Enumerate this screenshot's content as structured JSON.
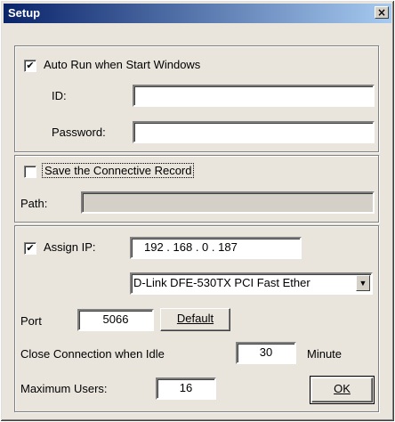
{
  "window": {
    "title": "Setup",
    "close_label": "×"
  },
  "autorun": {
    "checked_mark": "✔",
    "label": "Auto Run when Start Windows",
    "id_label": "ID:",
    "id_value": "",
    "password_label": "Password:",
    "password_value": ""
  },
  "record": {
    "checked_mark": "",
    "label": "Save the Connective Record",
    "path_label": "Path:",
    "path_value": ""
  },
  "network": {
    "assign_checked_mark": "✔",
    "assign_label": "Assign IP:",
    "ip_value": "192 . 168 .   0   . 187",
    "adapter_selected": "D-Link DFE-530TX PCI Fast Ether",
    "dropdown_arrow": "▼",
    "port_label": "Port",
    "port_value": "5066",
    "default_button": "Default",
    "idle_label": "Close Connection when Idle",
    "idle_value": "30",
    "idle_unit": "Minute",
    "max_users_label": "Maximum Users:",
    "max_users_value": "16",
    "ok_button": "OK"
  }
}
